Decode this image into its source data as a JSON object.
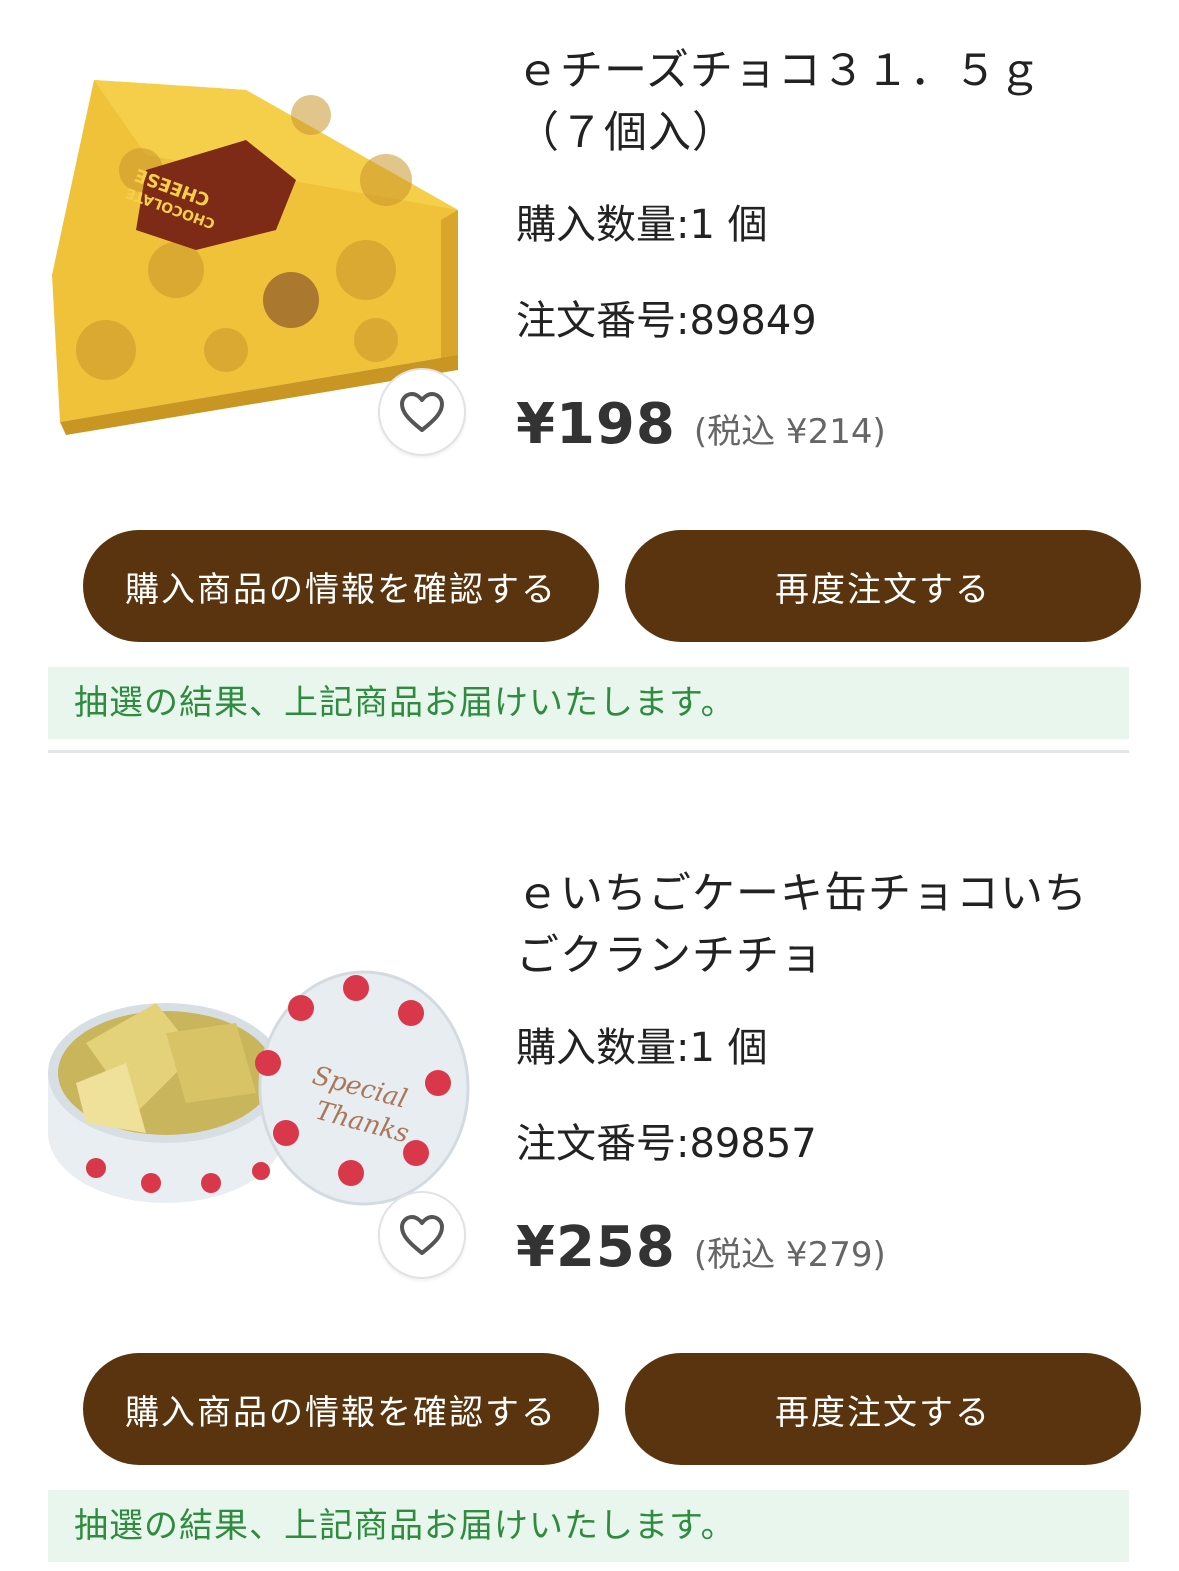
{
  "items": [
    {
      "name": "ｅチーズチョコ３１．５ｇ（７個入）",
      "quantity_label": "購入数量:1 個",
      "order_label": "注文番号:89849",
      "price": "¥198",
      "price_tax": "(税込 ¥214)",
      "favorite_icon": "heart-outline-icon",
      "image_text_1": "CHEESE",
      "image_text_2": "CHOCOLATE",
      "details_button": "購入商品の情報を確認する",
      "reorder_button": "再度注文する",
      "notice": "抽選の結果、上記商品お届けいたします。"
    },
    {
      "name": "ｅいちごケーキ缶チョコいちごクランチチョ",
      "quantity_label": "購入数量:1 個",
      "order_label": "注文番号:89857",
      "price": "¥258",
      "price_tax": "(税込 ¥279)",
      "favorite_icon": "heart-outline-icon",
      "image_text_1": "Special",
      "image_text_2": "Thanks",
      "details_button": "購入商品の情報を確認する",
      "reorder_button": "再度注文する",
      "notice": "抽選の結果、上記商品お届けいたします。"
    }
  ],
  "colors": {
    "button_bg": "#5a340e",
    "notice_bg": "#e8f6ee",
    "notice_text": "#2f8b3e"
  }
}
